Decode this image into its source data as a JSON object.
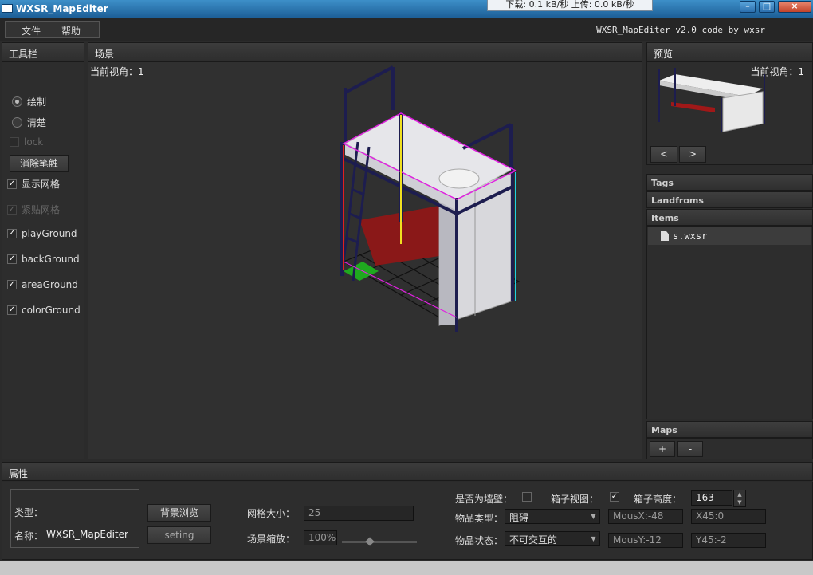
{
  "window": {
    "title": "WXSR_MapEditer",
    "netspeed": "下载: 0.1 kB/秒  上传: 0.0 kB/秒",
    "minimize": "–",
    "maximize": "□",
    "close": "×"
  },
  "menu": {
    "file": "文件",
    "help": "帮助",
    "credit": "WXSR_MapEditer v2.0  code by wxsr"
  },
  "toolbar": {
    "title": "工具栏",
    "radio_draw": "绘制",
    "radio_clear": "清楚",
    "lock": "lock",
    "erase_button": "消除笔触",
    "show_grid": "显示网格",
    "snap_grid": "紧贴网格",
    "playground": "playGround",
    "background": "backGround",
    "areaground": "areaGround",
    "colorground": "colorGround"
  },
  "scene": {
    "title": "场景",
    "view_label": "当前视角：1"
  },
  "preview": {
    "title": "预览",
    "view_label": "当前视角：1",
    "prev": "<",
    "next": ">"
  },
  "library": {
    "tags": "Tags",
    "landforms": "Landfroms",
    "items": "Items",
    "item_list": [
      "s.wxsr"
    ],
    "maps": "Maps",
    "add": "+",
    "remove": "-"
  },
  "properties": {
    "title": "属性",
    "type_label": "类型：",
    "name_label": "名称：",
    "name_value": "WXSR_MapEditer",
    "bg_browse": "背景浏览",
    "setting": "seting",
    "grid_size_label": "网格大小：",
    "grid_size_value": "25",
    "scene_zoom_label": "场景缩放：",
    "scene_zoom_value": "100%",
    "zoom_slider_level": 0.37,
    "is_wall_label": "是否为墙壁：",
    "box_view_label": "箱子视图：",
    "box_height_label": "箱子高度：",
    "box_height_value": "163",
    "item_type_label": "物品类型：",
    "item_type_value": "阻碍",
    "item_state_label": "物品状态：",
    "item_state_value": "不可交互的",
    "mouse_x": "MousX:-48",
    "x45": "X45:0",
    "mouse_y": "MousY:-12",
    "y45": "Y45:-2"
  },
  "colors": {
    "accent_title": "#2a6aa6",
    "outline_magenta": "#e020e0",
    "axis_yellow": "#f0e020",
    "axis_red": "#e02020",
    "axis_cyan": "#20d0e0",
    "floor_green": "#20b020"
  }
}
